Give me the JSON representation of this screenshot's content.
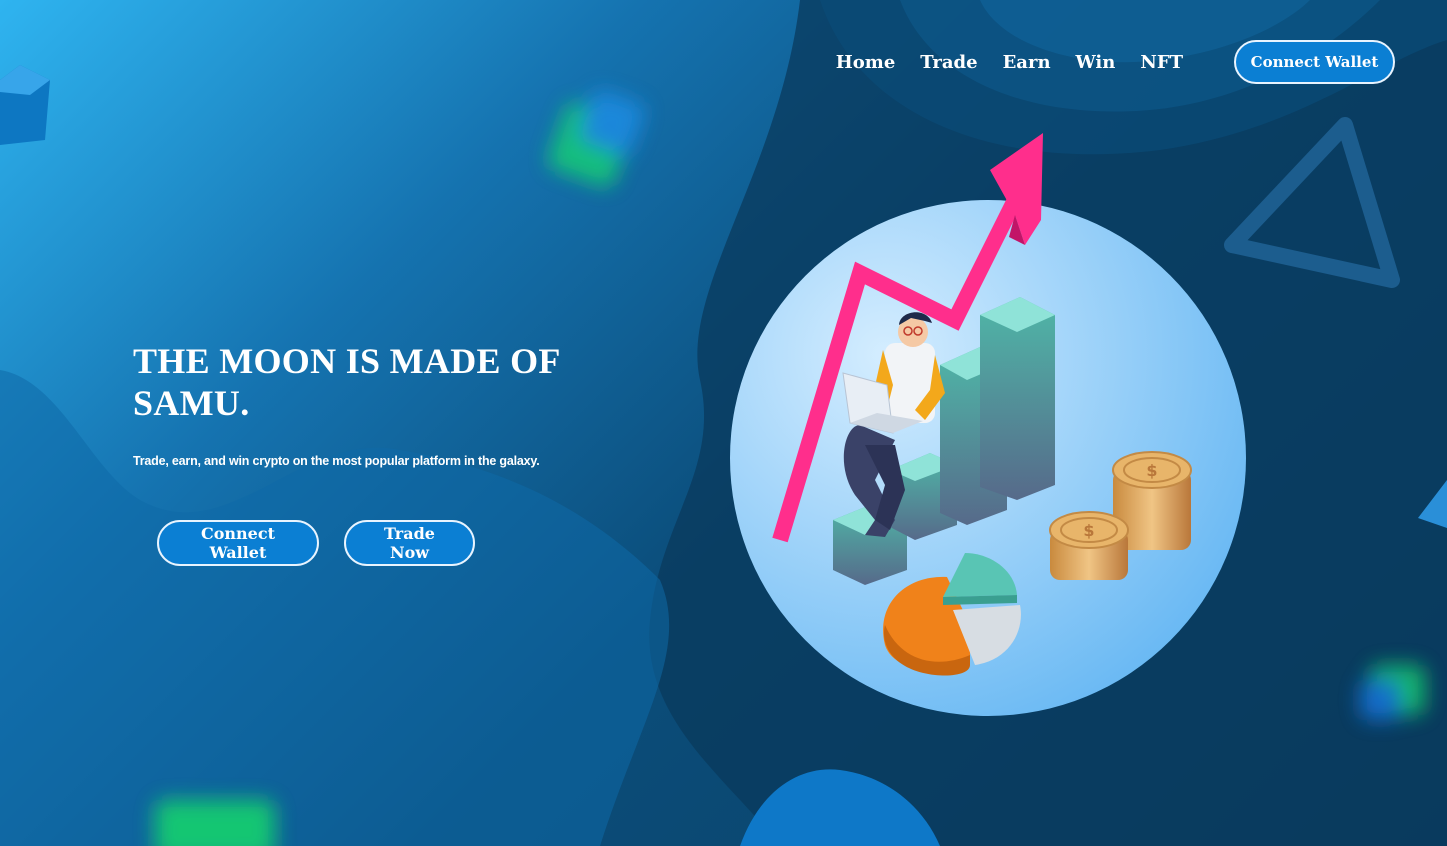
{
  "nav": {
    "links": [
      "Home",
      "Trade",
      "Earn",
      "Win",
      "NFT"
    ],
    "connect_wallet": "Connect Wallet"
  },
  "hero": {
    "title_line1": "THE MOON IS MADE OF",
    "title_line2": "SAMU.",
    "subtitle": "Trade, earn, and win crypto on the most popular platform in the galaxy.",
    "connect_wallet": "Connect Wallet",
    "trade_now": "Trade Now"
  },
  "colors": {
    "accent_button": "#0b7fd3",
    "arrow_pink": "#ff2e8c",
    "circle_light": "#9fd6ff",
    "background_dark": "#0b3a5c"
  },
  "icons": [
    "trend-arrow-icon",
    "bar-chart-icon",
    "coin-stack-icon",
    "pie-chart-icon",
    "person-laptop-icon",
    "triangle-shape-icon",
    "cube-shape-icon"
  ]
}
